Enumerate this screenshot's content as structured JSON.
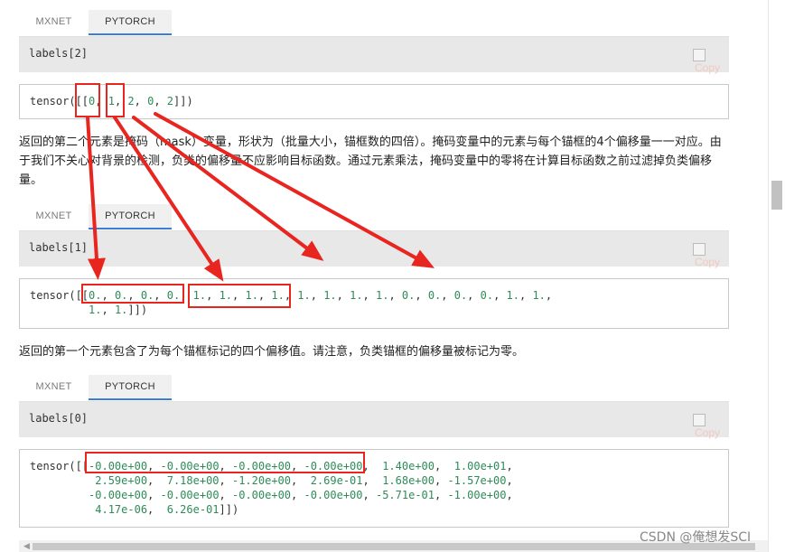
{
  "blocks": [
    {
      "tabs": [
        "MXNET",
        "PYTORCH"
      ],
      "input_code": "labels[2]",
      "copy_label": "Copy",
      "output_html": "tensor([[<span class=\"num\">0</span>, <span class=\"num\">1</span>, <span class=\"num\">2</span>, <span class=\"num\">0</span>, <span class=\"num\">2</span>]])"
    },
    {
      "tabs": [
        "MXNET",
        "PYTORCH"
      ],
      "input_code": "labels[1]",
      "copy_label": "Copy",
      "output_html": "tensor([[<span class=\"num\">0.</span>, <span class=\"num\">0.</span>, <span class=\"num\">0.</span>, <span class=\"num\">0.</span>, <span class=\"num\">1.</span>, <span class=\"num\">1.</span>, <span class=\"num\">1.</span>, <span class=\"num\">1.</span>, <span class=\"num\">1.</span>, <span class=\"num\">1.</span>, <span class=\"num\">1.</span>, <span class=\"num\">1.</span>, <span class=\"num\">0.</span>, <span class=\"num\">0.</span>, <span class=\"num\">0.</span>, <span class=\"num\">0.</span>, <span class=\"num\">1.</span>, <span class=\"num\">1.</span>,\n         <span class=\"num\">1.</span>, <span class=\"num\">1.</span>]])"
    },
    {
      "tabs": [
        "MXNET",
        "PYTORCH"
      ],
      "input_code": "labels[0]",
      "copy_label": "Copy",
      "output_html": "tensor([[<span class=\"num\">-0.00e+00</span>, <span class=\"num\">-0.00e+00</span>, <span class=\"num\">-0.00e+00</span>, <span class=\"num\">-0.00e+00</span>,  <span class=\"num\">1.40e+00</span>,  <span class=\"num\">1.00e+01</span>,\n          <span class=\"num\">2.59e+00</span>,  <span class=\"num\">7.18e+00</span>, <span class=\"num\">-1.20e+00</span>,  <span class=\"num\">2.69e-01</span>,  <span class=\"num\">1.68e+00</span>, <span class=\"num\">-1.57e+00</span>,\n         <span class=\"num\">-0.00e+00</span>, <span class=\"num\">-0.00e+00</span>, <span class=\"num\">-0.00e+00</span>, <span class=\"num\">-0.00e+00</span>, <span class=\"num\">-5.71e-01</span>, <span class=\"num\">-1.00e+00</span>,\n          <span class=\"num\">4.17e-06</span>,  <span class=\"num\">6.26e-01</span>]])"
    }
  ],
  "paragraph1": "返回的第二个元素是掩码（mask）变量，形状为（批量大小，锚框数的四倍）。掩码变量中的元素与每个锚框的4个偏移量一一对应。由于我们不关心对背景的检测，负类的偏移量不应影响目标函数。通过元素乘法，掩码变量中的零将在计算目标函数之前过滤掉负类偏移量。",
  "paragraph2": "返回的第一个元素包含了为每个锚框标记的四个偏移值。请注意，负类锚框的偏移量被标记为零。",
  "watermark": "CSDN @俺想发SCI",
  "colors": {
    "annotation": "#e8251f",
    "number": "#2e8b57",
    "tab_underline": "#3b7dd8"
  }
}
